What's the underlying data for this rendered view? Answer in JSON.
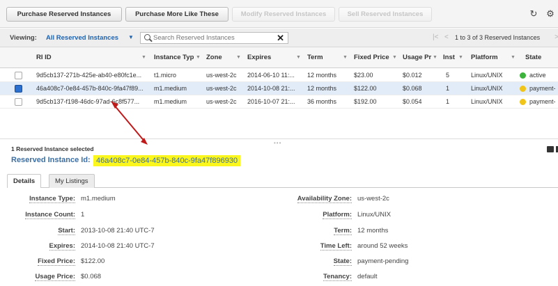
{
  "toolbar": {
    "purchase_ri": "Purchase Reserved Instances",
    "purchase_more": "Purchase More Like These",
    "modify_ri": "Modify Reserved Instances",
    "sell_ri": "Sell Reserved Instances",
    "refresh_icon": "refresh-icon",
    "settings_icon": "gear-icon"
  },
  "filter": {
    "viewing_label": "Viewing:",
    "viewing_value": "All Reserved Instances",
    "search_placeholder": "Search Reserved Instances",
    "pager_text": "1 to 3 of 3 Reserved Instances"
  },
  "table": {
    "columns": [
      "RI ID",
      "Instance Typ",
      "Zone",
      "Expires",
      "Term",
      "Fixed Price",
      "Usage Pr",
      "Inst",
      "Platform",
      "State"
    ],
    "rows": [
      {
        "ri_id": "9d5cb137-271b-425e-ab40-e80fc1e...",
        "type": "t1.micro",
        "zone": "us-west-2c",
        "expires": "2014-06-10 11:...",
        "term": "12 months",
        "fixed_price": "$23.00",
        "usage_price": "$0.012",
        "count": "5",
        "platform": "Linux/UNIX",
        "state": "active",
        "state_color": "#3cb43c",
        "selected": false
      },
      {
        "ri_id": "46a408c7-0e84-457b-840c-9fa47f89...",
        "type": "m1.medium",
        "zone": "us-west-2c",
        "expires": "2014-10-08 21:...",
        "term": "12 months",
        "fixed_price": "$122.00",
        "usage_price": "$0.068",
        "count": "1",
        "platform": "Linux/UNIX",
        "state": "payment-",
        "state_color": "#f0c419",
        "selected": true
      },
      {
        "ri_id": "9d5cb137-f198-46dc-97ad-6c8f577...",
        "type": "m1.medium",
        "zone": "us-west-2c",
        "expires": "2016-10-07 21:...",
        "term": "36 months",
        "fixed_price": "$192.00",
        "usage_price": "$0.054",
        "count": "1",
        "platform": "Linux/UNIX",
        "state": "payment-",
        "state_color": "#f0c419",
        "selected": false
      }
    ]
  },
  "detail": {
    "selected_count": "1 Reserved Instance selected",
    "ri_label": "Reserved Instance Id:",
    "ri_value": "46a408c7-0e84-457b-840c-9fa47f896930",
    "tabs": [
      "Details",
      "My Listings"
    ],
    "left": [
      {
        "label": "Instance Type:",
        "value": "m1.medium"
      },
      {
        "label": "Instance Count:",
        "value": "1"
      },
      {
        "label": "Start:",
        "value": "2013-10-08 21:40 UTC-7"
      },
      {
        "label": "Expires:",
        "value": "2014-10-08 21:40 UTC-7"
      },
      {
        "label": "Fixed Price:",
        "value": "$122.00"
      },
      {
        "label": "Usage Price:",
        "value": "$0.068"
      }
    ],
    "right": [
      {
        "label": "Availability Zone:",
        "value": "us-west-2c"
      },
      {
        "label": "Platform:",
        "value": "Linux/UNIX"
      },
      {
        "label": "Term:",
        "value": "12 months"
      },
      {
        "label": "Time Left:",
        "value": "around 52 weeks"
      },
      {
        "label": "State:",
        "value": "payment-pending"
      },
      {
        "label": "Tenancy:",
        "value": "default"
      }
    ]
  },
  "colors": {
    "highlight": "#fbf61c",
    "link_blue": "#3a6ea5",
    "annotation_arrow": "#c0191a",
    "selected_row": "#e1ecf8"
  }
}
